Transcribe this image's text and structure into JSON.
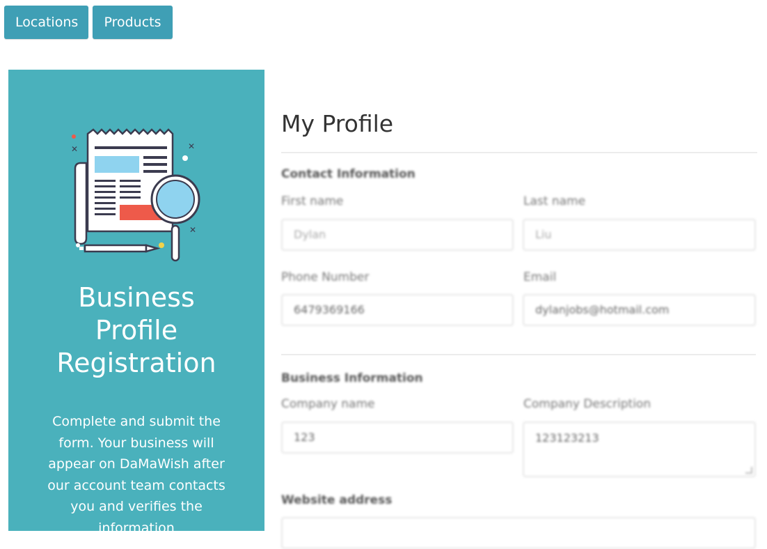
{
  "nav": {
    "locations_label": "Locations",
    "products_label": "Products"
  },
  "sidebar": {
    "title_lines": [
      "Business",
      "Profile",
      "Registration"
    ],
    "description": "Complete and submit the form. Your business will appear on DaMaWish after our account team contacts you and verifies the information",
    "background_color": "#4ab1bc",
    "illustration": "newspaper-magnifier-icon"
  },
  "main": {
    "title": "My Profile",
    "contact": {
      "heading": "Contact Information",
      "first_name_label": "First name",
      "first_name_value": "Dylan",
      "last_name_label": "Last name",
      "last_name_value": "Liu",
      "phone_label": "Phone Number",
      "phone_value": "6479369166",
      "email_label": "Email",
      "email_value": "dylanjobs@hotmail.com"
    },
    "business": {
      "heading": "Business Information",
      "company_name_label": "Company name",
      "company_name_value": "123",
      "company_desc_label": "Company Description",
      "company_desc_value": "123123213",
      "website_label": "Website address",
      "website_value": ""
    }
  },
  "colors": {
    "accent": "#3f9fb5",
    "panel": "#4ab1bc"
  }
}
